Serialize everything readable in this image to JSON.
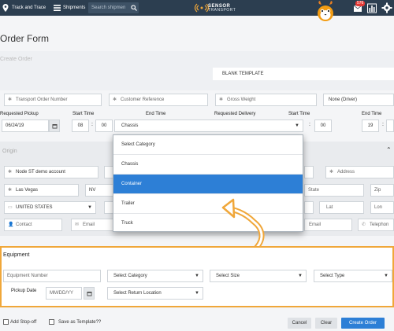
{
  "nav": {
    "track_label": "Track and Trace",
    "shipments_label": "Shipments",
    "search_placeholder": "Search shipmen",
    "logo_text": "SENSOR",
    "logo_sub": "TRANSPORT",
    "notification_count": "576"
  },
  "page": {
    "title": "Order Form",
    "section_create": "Create Order",
    "template_value": "BLANK TEMPLATE"
  },
  "order": {
    "transport_order_number": "Transport Order Number",
    "customer_reference": "Customer Reference",
    "gross_weight": "Gross Weight",
    "driver": "None (Driver)",
    "requested_pickup_label": "Requested Pickup",
    "requested_pickup_value": "06/24/19",
    "start_time_label": "Start Time",
    "start_hour": "08",
    "start_minute": "00",
    "end_time_label": "End Time",
    "category_selected": "Chassis",
    "requested_delivery_label": "Requested Delivery",
    "delivery_start_label": "Start Time",
    "delivery_minute": "00",
    "delivery_end_label": "End Time",
    "delivery_end_hour": "19"
  },
  "dropdown": {
    "options": [
      "Select Category",
      "Chassis",
      "Container",
      "Trailer",
      "Truck"
    ],
    "highlighted_index": 2
  },
  "origin": {
    "label": "Origin",
    "account": "Node ST demo account",
    "city": "Las Vegas",
    "state": "NV",
    "country": "UNITED STATES",
    "contact": "Contact",
    "email": "Email",
    "address": "Address",
    "dest_state": "State",
    "zip": "Zip",
    "lat": "Lat",
    "lon": "Lon",
    "dest_email": "Email",
    "telephone": "Telephon"
  },
  "equipment": {
    "title": "Equipment",
    "equipment_number": "Equipment Number",
    "select_category": "Select Category",
    "select_size": "Select Size",
    "select_type": "Select Type",
    "pickup_date_label": "Pickup Date",
    "pickup_date_placeholder": "MM/DD/YY",
    "select_return_location": "Select Return Location"
  },
  "footer": {
    "add_stop_off": "Add Stop-off",
    "save_as_template": "Save as Template??",
    "cancel": "Cancel",
    "clear": "Clear",
    "create_order": "Create Order"
  },
  "colors": {
    "topbar": "#2c3e50",
    "accent_blue": "#2d7fd6",
    "highlight_orange": "#f0a73a"
  }
}
